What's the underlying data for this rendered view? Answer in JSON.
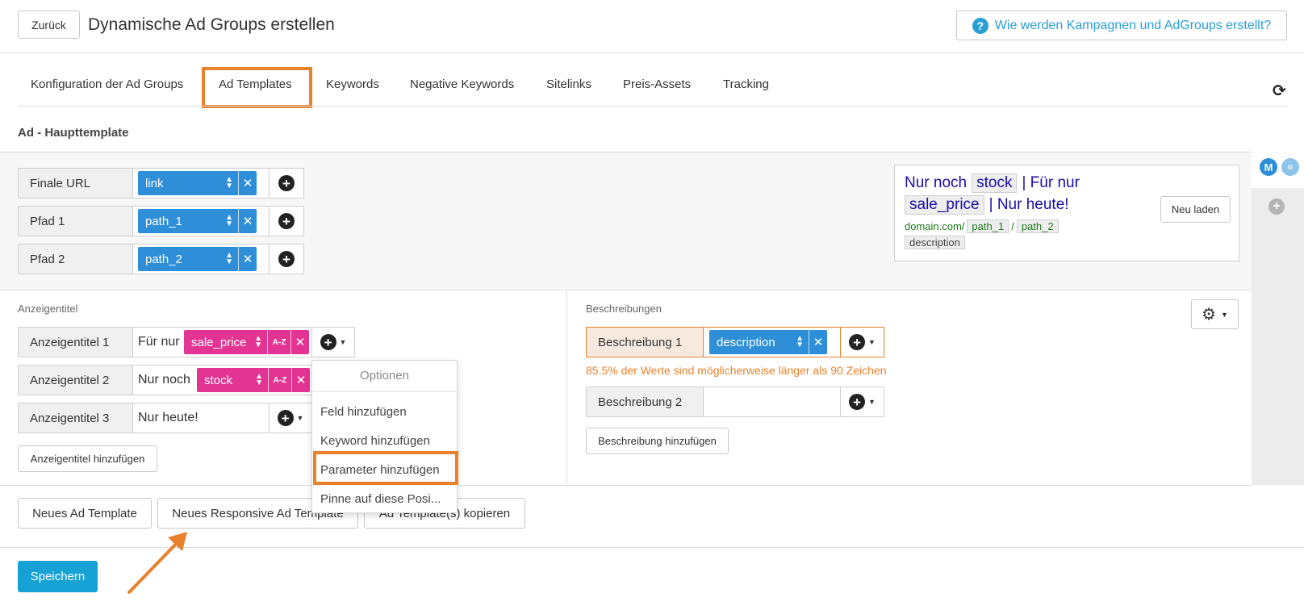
{
  "header": {
    "back_label": "Zurück",
    "title": "Dynamische Ad Groups erstellen",
    "help_label": "Wie werden Kampagnen und AdGroups erstellt?"
  },
  "tabs": [
    {
      "label": "Konfiguration der Ad Groups",
      "active": false
    },
    {
      "label": "Ad Templates",
      "active": true
    },
    {
      "label": "Keywords",
      "active": false
    },
    {
      "label": "Negative Keywords",
      "active": false
    },
    {
      "label": "Sitelinks",
      "active": false
    },
    {
      "label": "Preis-Assets",
      "active": false
    },
    {
      "label": "Tracking",
      "active": false
    }
  ],
  "section_title": "Ad - Haupttemplate",
  "url_fields": [
    {
      "label": "Finale URL",
      "value": "link"
    },
    {
      "label": "Pfad 1",
      "value": "path_1"
    },
    {
      "label": "Pfad 2",
      "value": "path_2"
    }
  ],
  "preview": {
    "line1_prefix": "Nur noch",
    "line1_token": "stock",
    "line1_suffix": "| Für nur",
    "line2_token": "sale_price",
    "line2_suffix": "| Nur heute!",
    "url_domain": "domain.com/",
    "url_token1": "path_1",
    "url_sep": "/",
    "url_token2": "path_2",
    "desc_token": "description",
    "reload_label": "Neu laden"
  },
  "sidebar": {
    "avatar_letter": "M"
  },
  "headlines": {
    "section_label": "Anzeigentitel",
    "rows": [
      {
        "label": "Anzeigentitel 1",
        "text": "Für nur",
        "token": "sale_price"
      },
      {
        "label": "Anzeigentitel 2",
        "text": "Nur noch",
        "token": "stock"
      },
      {
        "label": "Anzeigentitel 3",
        "text": "Nur heute!",
        "token": ""
      }
    ],
    "add_label": "Anzeigentitel hinzufügen",
    "az_label": "A-Z"
  },
  "descriptions": {
    "section_label": "Beschreibungen",
    "rows": [
      {
        "label": "Beschreibung 1",
        "token": "description"
      },
      {
        "label": "Beschreibung 2",
        "token": ""
      }
    ],
    "warning": "85.5% der Werte sind möglicherweise länger als 90 Zeichen",
    "add_label": "Beschreibung hinzufügen"
  },
  "dropdown": {
    "header": "Optionen",
    "items": [
      "Feld hinzufügen",
      "Keyword hinzufügen",
      "Parameter hinzufügen",
      "Pinne auf diese Posi..."
    ]
  },
  "footer": {
    "new_template": "Neues Ad Template",
    "new_responsive": "Neues Responsive Ad Template",
    "copy_templates": "Ad Template(s) kopieren",
    "save": "Speichern"
  },
  "colors": {
    "accent_blue": "#2e8fd8",
    "token_pink": "#e33493",
    "highlight_orange": "#e8812c",
    "save_blue": "#17a2d6",
    "warning_orange": "#e8812c"
  }
}
